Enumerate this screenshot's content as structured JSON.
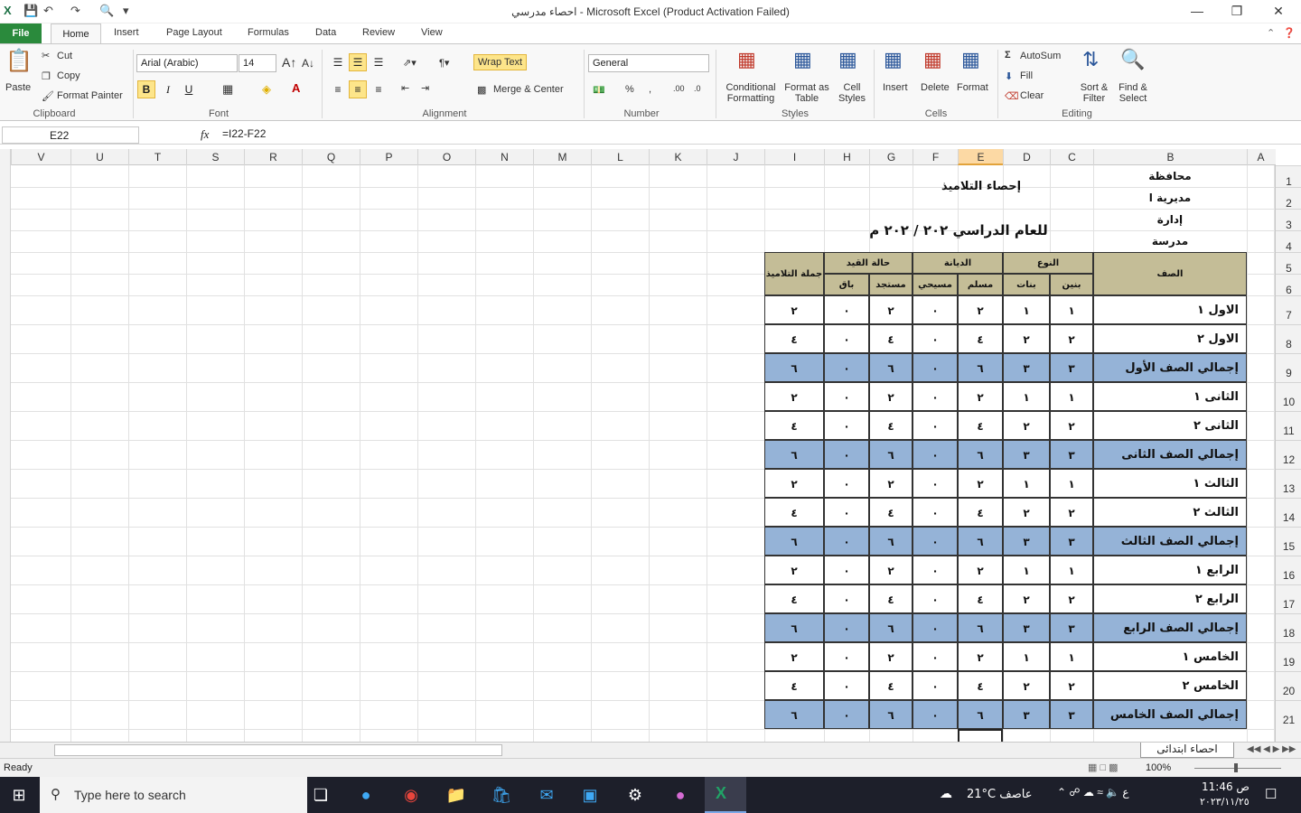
{
  "window": {
    "title": "احصاء مدرسي  -  Microsoft Excel (Product Activation Failed)"
  },
  "tabs": [
    "File",
    "Home",
    "Insert",
    "Page Layout",
    "Formulas",
    "Data",
    "Review",
    "View"
  ],
  "ribbon": {
    "clipboard": {
      "paste": "Paste",
      "cut": "Cut",
      "copy": "Copy",
      "format_painter": "Format Painter",
      "label": "Clipboard"
    },
    "font": {
      "name": "Arial (Arabic)",
      "size": "14",
      "label": "Font"
    },
    "alignment": {
      "wrap": "Wrap Text",
      "merge": "Merge & Center",
      "label": "Alignment"
    },
    "number": {
      "format": "General",
      "label": "Number"
    },
    "styles": {
      "conditional": "Conditional Formatting",
      "format_table": "Format as Table",
      "cell_styles": "Cell Styles",
      "label": "Styles"
    },
    "cells": {
      "insert": "Insert",
      "delete": "Delete",
      "format": "Format",
      "label": "Cells"
    },
    "editing": {
      "autosum": "AutoSum",
      "fill": "Fill",
      "clear": "Clear",
      "sort": "Sort & Filter",
      "find": "Find & Select",
      "label": "Editing"
    }
  },
  "formula_bar": {
    "name_box": "E22",
    "fx": "fx",
    "formula": "=I22-F22"
  },
  "columns": [
    "V",
    "U",
    "T",
    "S",
    "R",
    "Q",
    "P",
    "O",
    "N",
    "M",
    "L",
    "K",
    "J",
    "I",
    "H",
    "G",
    "F",
    "E",
    "D",
    "C",
    "B",
    "A"
  ],
  "rows": [
    "1",
    "2",
    "3",
    "4",
    "5",
    "6",
    "7",
    "8",
    "9",
    "10",
    "11",
    "12",
    "13",
    "14",
    "15",
    "16",
    "17",
    "18",
    "19",
    "20",
    "21"
  ],
  "sheet": {
    "b1": "محافظة",
    "b2": "مديرية ا",
    "b3": "إدارة",
    "b4": "مدرسة",
    "title": "إحصاء التلاميذ",
    "year": "للعام الدراسي ٢٠٢ / ٢٠٢ م",
    "hdr_class": "الصف",
    "hdr_type": "النوع",
    "hdr_religion": "الديانة",
    "hdr_status": "حالة القيد",
    "hdr_total": "جملة التلاميذ",
    "hdr_boys": "بنين",
    "hdr_girls": "بنات",
    "hdr_muslim": "مسلم",
    "hdr_christian": "مسيحي",
    "hdr_new": "مستجد",
    "hdr_remain": "باق",
    "rows": [
      {
        "name": "الاول  ١",
        "vals": [
          "١",
          "١",
          "٢",
          "٠",
          "٢",
          "٠",
          "٢"
        ],
        "total": false
      },
      {
        "name": "الاول  ٢",
        "vals": [
          "٢",
          "٢",
          "٤",
          "٠",
          "٤",
          "٠",
          "٤"
        ],
        "total": false
      },
      {
        "name": "إجمالي الصف الأول",
        "vals": [
          "٣",
          "٣",
          "٦",
          "٠",
          "٦",
          "٠",
          "٦"
        ],
        "total": true
      },
      {
        "name": "الثانى  ١",
        "vals": [
          "١",
          "١",
          "٢",
          "٠",
          "٢",
          "٠",
          "٢"
        ],
        "total": false
      },
      {
        "name": "الثانى  ٢",
        "vals": [
          "٢",
          "٢",
          "٤",
          "٠",
          "٤",
          "٠",
          "٤"
        ],
        "total": false
      },
      {
        "name": "إجمالي الصف الثانى",
        "vals": [
          "٣",
          "٣",
          "٦",
          "٠",
          "٦",
          "٠",
          "٦"
        ],
        "total": true
      },
      {
        "name": "الثالث  ١",
        "vals": [
          "١",
          "١",
          "٢",
          "٠",
          "٢",
          "٠",
          "٢"
        ],
        "total": false
      },
      {
        "name": "الثالث  ٢",
        "vals": [
          "٢",
          "٢",
          "٤",
          "٠",
          "٤",
          "٠",
          "٤"
        ],
        "total": false
      },
      {
        "name": "إجمالي الصف الثالث",
        "vals": [
          "٣",
          "٣",
          "٦",
          "٠",
          "٦",
          "٠",
          "٦"
        ],
        "total": true
      },
      {
        "name": "الرابع  ١",
        "vals": [
          "١",
          "١",
          "٢",
          "٠",
          "٢",
          "٠",
          "٢"
        ],
        "total": false
      },
      {
        "name": "الرابع  ٢",
        "vals": [
          "٢",
          "٢",
          "٤",
          "٠",
          "٤",
          "٠",
          "٤"
        ],
        "total": false
      },
      {
        "name": "إجمالي الصف الرابع",
        "vals": [
          "٣",
          "٣",
          "٦",
          "٠",
          "٦",
          "٠",
          "٦"
        ],
        "total": true
      },
      {
        "name": "الخامس  ١",
        "vals": [
          "١",
          "١",
          "٢",
          "٠",
          "٢",
          "٠",
          "٢"
        ],
        "total": false
      },
      {
        "name": "الخامس  ٢",
        "vals": [
          "٢",
          "٢",
          "٤",
          "٠",
          "٤",
          "٠",
          "٤"
        ],
        "total": false
      },
      {
        "name": "إجمالي الصف الخامس",
        "vals": [
          "٣",
          "٣",
          "٦",
          "٠",
          "٦",
          "٠",
          "٦"
        ],
        "total": true
      }
    ]
  },
  "sheet_tab": "احصاء ابتدائى",
  "status": {
    "ready": "Ready",
    "zoom": "100%"
  },
  "taskbar": {
    "search": "Type here to search",
    "weather": "21°C  عاصف",
    "time": "11:46 ص",
    "date": "٢٠٢٣/١١/٢٥"
  },
  "colors": {
    "file_tab": "#2a8a3c",
    "header_fill": "#c4bd97",
    "total_fill": "#95b3d7",
    "selected": "#fde58a"
  }
}
